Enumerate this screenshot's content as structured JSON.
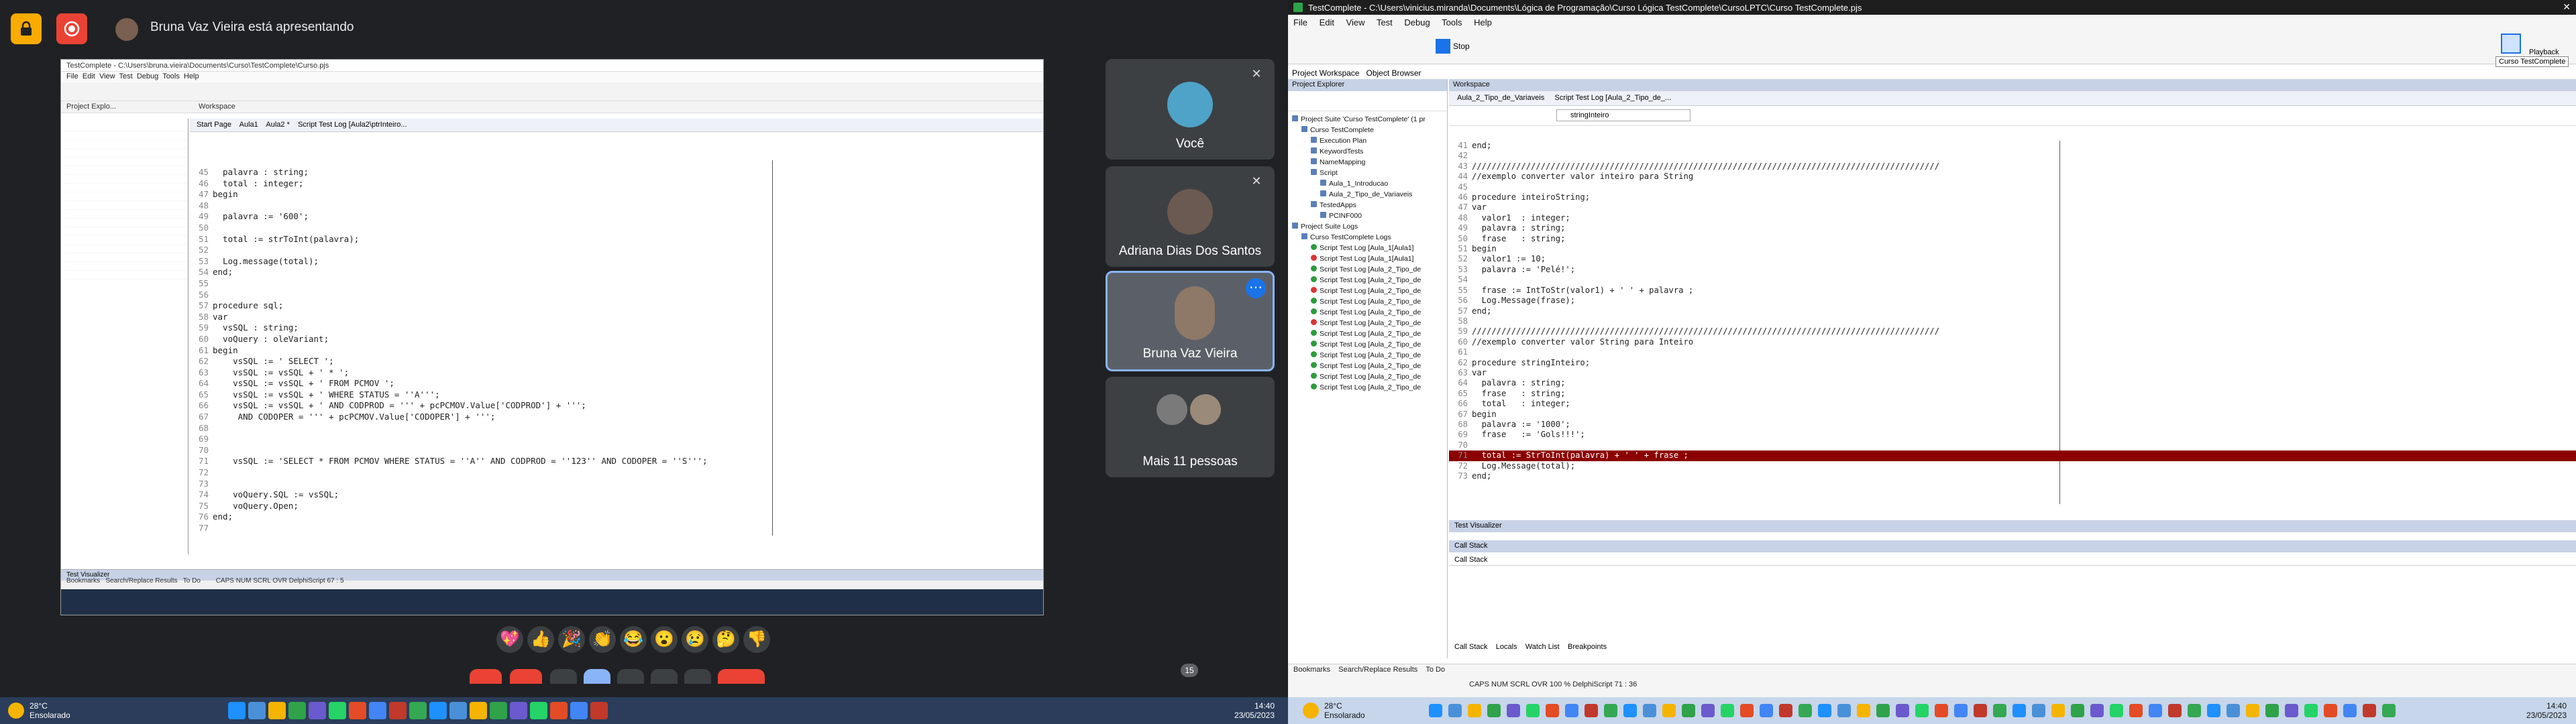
{
  "meet": {
    "presenter_text": "Bruna Vaz Vieira está apresentando",
    "participants": [
      {
        "name": "Você"
      },
      {
        "name": "Adriana Dias Dos Santos"
      },
      {
        "name": "Bruna Vaz Vieira"
      },
      {
        "name": "Mais 11 pessoas"
      }
    ],
    "reactions": [
      "💖",
      "👍",
      "🎉",
      "👏",
      "😂",
      "😮",
      "😢",
      "🤔",
      "👎"
    ],
    "raise_count": "15"
  },
  "shared_screen": {
    "title": "TestComplete - C:\\Users\\bruna.vieira\\Documents\\Curso\\TestComplete\\Curso.pjs",
    "menu": [
      "File",
      "Edit",
      "View",
      "Test",
      "Debug",
      "Tools",
      "Help"
    ],
    "explorer_title": "Project Explo...",
    "workspace_title": "Workspace",
    "tabs": [
      "Start Page",
      "Aula1",
      "Aula2 *",
      "Script Test Log [Aula2\\ptrInteiro..."
    ],
    "code_lines": [
      {
        "n": "45",
        "t": "  palavra : string;"
      },
      {
        "n": "46",
        "t": "  total : integer;"
      },
      {
        "n": "47",
        "t": "begin"
      },
      {
        "n": "48",
        "t": ""
      },
      {
        "n": "49",
        "t": "  palavra := '600';"
      },
      {
        "n": "50",
        "t": ""
      },
      {
        "n": "51",
        "t": "  total := strToInt(palavra);"
      },
      {
        "n": "52",
        "t": ""
      },
      {
        "n": "53",
        "t": "  Log.message(total);"
      },
      {
        "n": "54",
        "t": "end;"
      },
      {
        "n": "55",
        "t": ""
      },
      {
        "n": "56",
        "t": ""
      },
      {
        "n": "57",
        "t": "procedure sql;"
      },
      {
        "n": "58",
        "t": "var"
      },
      {
        "n": "59",
        "t": "  vsSQL : string;"
      },
      {
        "n": "60",
        "t": "  voQuery : oleVariant;"
      },
      {
        "n": "61",
        "t": "begin"
      },
      {
        "n": "62",
        "t": "    vsSQL := ' SELECT ';"
      },
      {
        "n": "63",
        "t": "    vsSQL := vsSQL + ' * ';"
      },
      {
        "n": "64",
        "t": "    vsSQL := vsSQL + ' FROM PCMOV ';"
      },
      {
        "n": "65",
        "t": "    vsSQL := vsSQL + ' WHERE STATUS = ''A''';"
      },
      {
        "n": "66",
        "t": "    vsSQL := vsSQL + ' AND CODPROD = ''' + pcPCMOV.Value['CODPROD'] + ''';"
      },
      {
        "n": "67",
        "t": "     AND CODOPER = ''' + pcPCMOV.Value['CODOPER'] + ''';"
      },
      {
        "n": "68",
        "t": ""
      },
      {
        "n": "69",
        "t": ""
      },
      {
        "n": "70",
        "t": ""
      },
      {
        "n": "71",
        "t": "    vsSQL := 'SELECT * FROM PCMOV WHERE STATUS = ''A'' AND CODPROD = ''123'' AND CODOPER = ''S''';"
      },
      {
        "n": "72",
        "t": ""
      },
      {
        "n": "73",
        "t": ""
      },
      {
        "n": "74",
        "t": "    voQuery.SQL := vsSQL;"
      },
      {
        "n": "75",
        "t": "    voQuery.Open;"
      },
      {
        "n": "76",
        "t": "end;"
      },
      {
        "n": "77",
        "t": ""
      }
    ],
    "bottom_tabs": [
      "Bookmarks",
      "Search/Replace Results",
      "To Do"
    ],
    "test_visualizer": "Test Visualizer",
    "status": "CAPS  NUM  SCRL  OVR  DelphiScript   67 : 5",
    "clock": "14:40\n23/05/2023"
  },
  "testcomplete": {
    "title": "TestComplete - C:\\Users\\vinicius.miranda\\Documents\\Lógica de Programação\\Curso Lógica TestComplete\\CursoLPTC\\Curso TestComplete.pjs",
    "menu": [
      "File",
      "Edit",
      "View",
      "Test",
      "Debug",
      "Tools",
      "Help"
    ],
    "stop_label": "Stop",
    "playback_label": "Playback",
    "tooltip": "Curso TestComplete",
    "panel_tabs": [
      "Project Workspace",
      "Object Browser"
    ],
    "explorer_title": "Project Explorer",
    "workspace_title": "Workspace",
    "doc_tabs": [
      "Aula_2_Tipo_de_Variaveis",
      "Script Test Log [Aula_2_Tipo_de_..."
    ],
    "routine_dropdown": "stringInteiro",
    "tree": [
      "Project Suite 'Curso TestComplete' (1 pr",
      "Curso TestComplete",
      "Execution Plan",
      "KeywordTests",
      "NameMapping",
      "Script",
      "Aula_1_Introducao",
      "Aula_2_Tipo_de_Variaveis",
      "TestedApps",
      "PCINF000",
      "Project Suite Logs",
      "Curso TestComplete Logs",
      "Script Test Log [Aula_1[Aula1]",
      "Script Test Log [Aula_1[Aula1]",
      "Script Test Log [Aula_2_Tipo_de",
      "Script Test Log [Aula_2_Tipo_de",
      "Script Test Log [Aula_2_Tipo_de",
      "Script Test Log [Aula_2_Tipo_de",
      "Script Test Log [Aula_2_Tipo_de",
      "Script Test Log [Aula_2_Tipo_de",
      "Script Test Log [Aula_2_Tipo_de",
      "Script Test Log [Aula_2_Tipo_de",
      "Script Test Log [Aula_2_Tipo_de",
      "Script Test Log [Aula_2_Tipo_de",
      "Script Test Log [Aula_2_Tipo_de",
      "Script Test Log [Aula_2_Tipo_de"
    ],
    "code_lines": [
      {
        "n": "41",
        "t": "end;",
        "h": false
      },
      {
        "n": "42",
        "t": "",
        "h": false
      },
      {
        "n": "43",
        "t": "///////////////////////////////////////////////////////////////////////////////////////////////",
        "h": false
      },
      {
        "n": "44",
        "t": "//exemplo converter valor inteiro para String",
        "h": false
      },
      {
        "n": "45",
        "t": "",
        "h": false
      },
      {
        "n": "46",
        "t": "procedure inteiroString;",
        "h": false
      },
      {
        "n": "47",
        "t": "var",
        "h": false
      },
      {
        "n": "48",
        "t": "  valor1  : integer;",
        "h": false
      },
      {
        "n": "49",
        "t": "  palavra : string;",
        "h": false
      },
      {
        "n": "50",
        "t": "  frase   : string;",
        "h": false
      },
      {
        "n": "51",
        "t": "begin",
        "h": false
      },
      {
        "n": "52",
        "t": "  valor1 := 10;",
        "h": false
      },
      {
        "n": "53",
        "t": "  palavra := 'Pelé!';",
        "h": false
      },
      {
        "n": "54",
        "t": "",
        "h": false
      },
      {
        "n": "55",
        "t": "  frase := IntToStr(valor1) + ' ' + palavra ;",
        "h": false
      },
      {
        "n": "56",
        "t": "  Log.Message(frase);",
        "h": false
      },
      {
        "n": "57",
        "t": "end;",
        "h": false
      },
      {
        "n": "58",
        "t": "",
        "h": false
      },
      {
        "n": "59",
        "t": "///////////////////////////////////////////////////////////////////////////////////////////////",
        "h": false
      },
      {
        "n": "60",
        "t": "//exemplo converter valor String para Inteiro",
        "h": false
      },
      {
        "n": "61",
        "t": "",
        "h": false
      },
      {
        "n": "62",
        "t": "procedure stringInteiro;",
        "h": false
      },
      {
        "n": "63",
        "t": "var",
        "h": false
      },
      {
        "n": "64",
        "t": "  palavra : string;",
        "h": false
      },
      {
        "n": "65",
        "t": "  frase   : string;",
        "h": false
      },
      {
        "n": "66",
        "t": "  total   : integer;",
        "h": false
      },
      {
        "n": "67",
        "t": "begin",
        "h": false
      },
      {
        "n": "68",
        "t": "  palavra := '1000';",
        "h": false
      },
      {
        "n": "69",
        "t": "  frase   := 'Gols!!!';",
        "h": false
      },
      {
        "n": "70",
        "t": "",
        "h": false
      },
      {
        "n": "71",
        "t": "  total := StrToInt(palavra) + ' ' + frase ;",
        "h": true
      },
      {
        "n": "72",
        "t": "  Log.Message(total);",
        "h": false
      },
      {
        "n": "73",
        "t": "end;",
        "h": false
      }
    ],
    "test_visualizer": "Test Visualizer",
    "call_stack_title": "Call Stack",
    "call_stack_header": "Call Stack",
    "debug_tabs": [
      "Call Stack",
      "Locals",
      "Watch List",
      "Breakpoints"
    ],
    "bottom_tabs": [
      "Bookmarks",
      "Search/Replace Results",
      "To Do"
    ],
    "status": "CAPS  NUM  SCRL  OVR  100 %  DelphiScript  71 : 36"
  },
  "taskbar_left": {
    "weather_temp": "28°C",
    "weather_desc": "Ensolarado",
    "time": "14:40",
    "date": "23/05/2023"
  },
  "taskbar_right": {
    "weather_temp": "28°C",
    "weather_desc": "Ensolarado",
    "time": "14:40",
    "date": "23/05/2023"
  }
}
